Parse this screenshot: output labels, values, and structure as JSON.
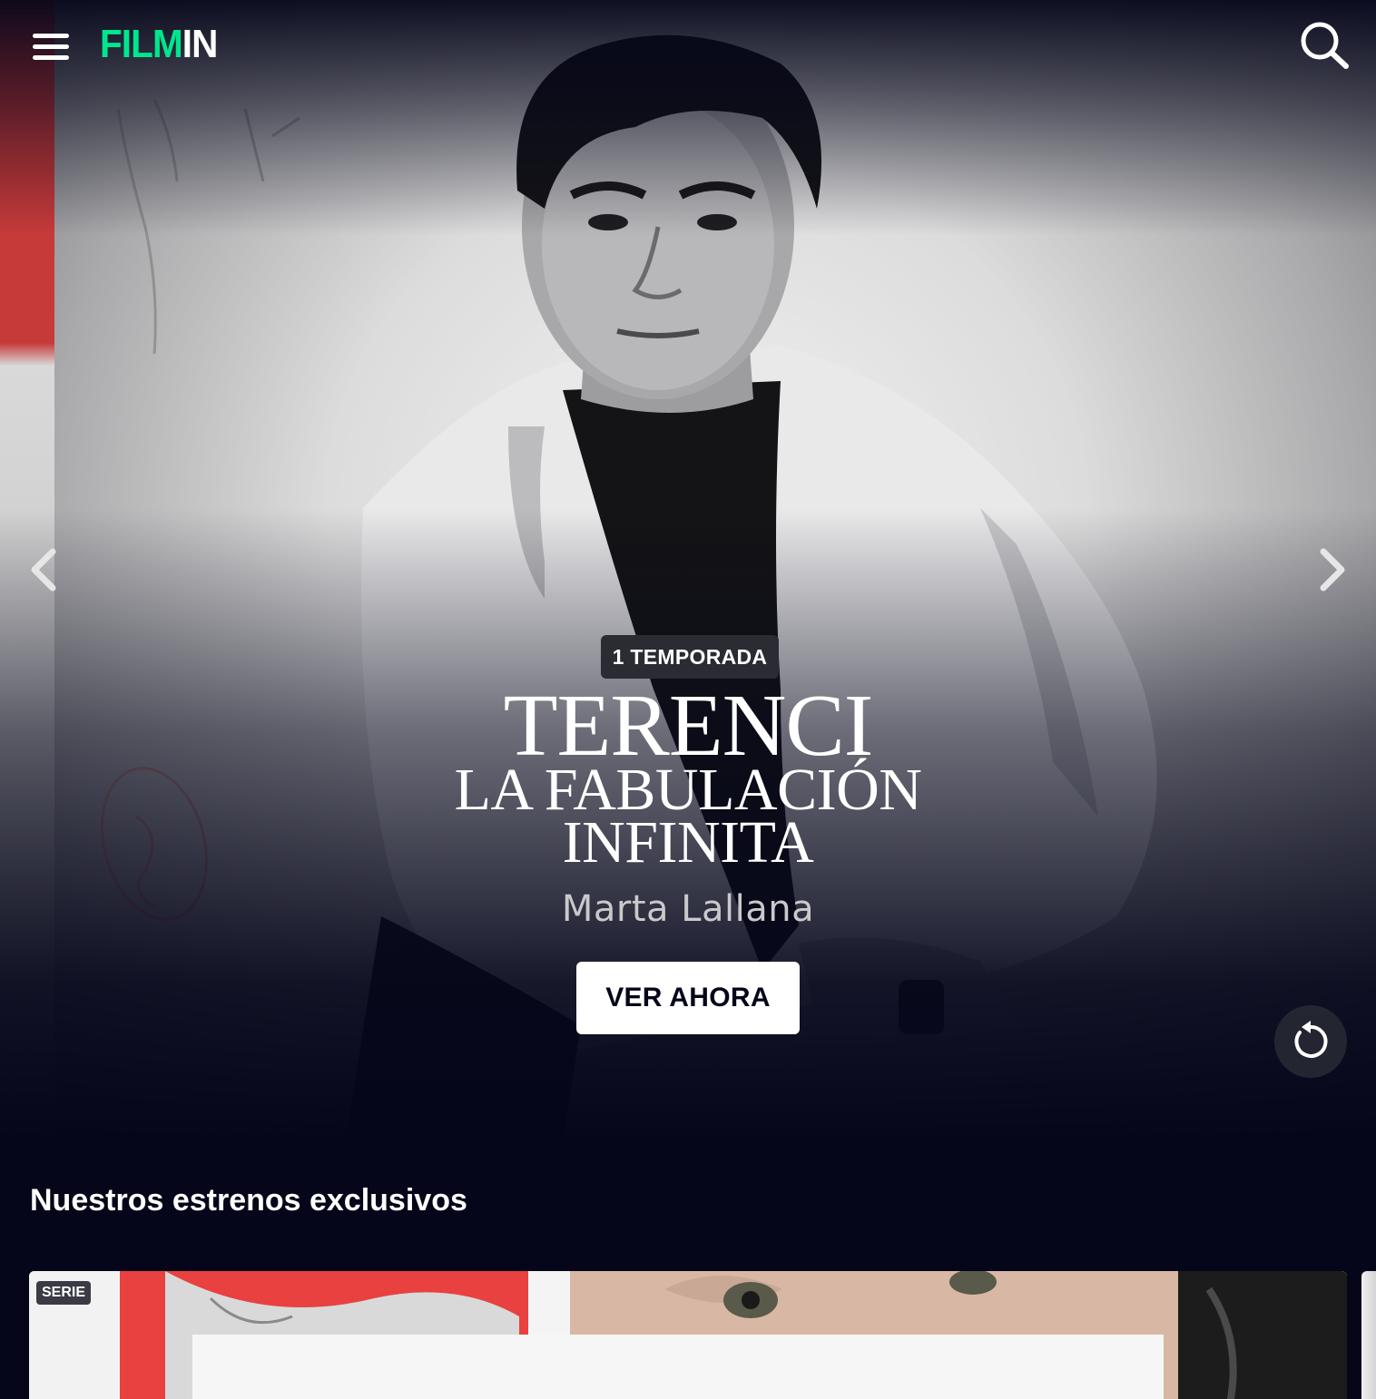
{
  "app": {
    "brand": {
      "part1": "FILM",
      "part2": "IN",
      "accent_color": "#00e68e"
    },
    "menu_icon": "hamburger-menu-icon",
    "search_icon": "search-icon"
  },
  "hero": {
    "badge": "1 TEMPORADA",
    "title_line1": "TERENCI",
    "title_line2": "LA FABULACIÓN",
    "title_line3": "INFINITA",
    "director": "Marta Lallana",
    "cta_label": "VER AHORA",
    "prev_icon": "chevron-left-icon",
    "next_icon": "chevron-right-icon",
    "replay_icon": "replay-icon"
  },
  "section": {
    "title": "Nuestros estrenos exclusivos",
    "cards": [
      {
        "badge": "SERIE"
      }
    ]
  },
  "colors": {
    "background": "#05061a",
    "cta_background": "#ffffff",
    "badge_background": "#2a2b33"
  }
}
